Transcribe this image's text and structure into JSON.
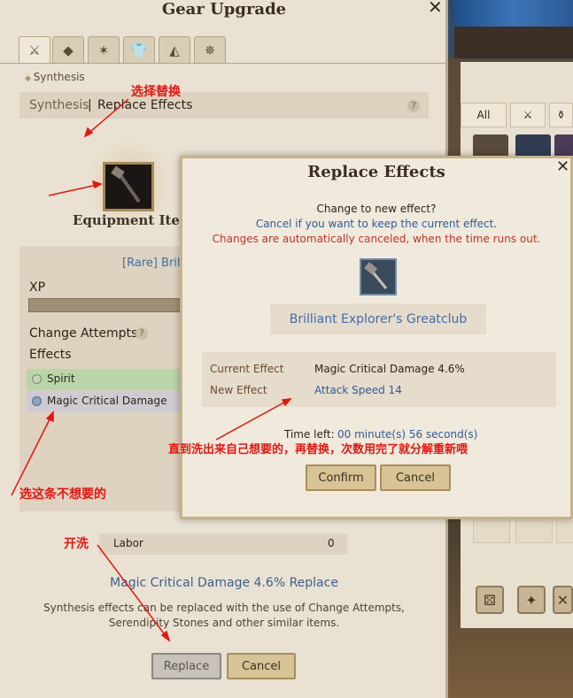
{
  "main": {
    "title": "Gear Upgrade",
    "close_glyph": "✕",
    "tabs": [
      "⚔",
      "◆",
      "✶",
      "👕",
      "◭",
      "✵"
    ],
    "breadcrumb": "Synthesis",
    "selection": {
      "synthesis": "Synthesis",
      "separator": "|",
      "replace": "Replace Effects",
      "help": "?"
    },
    "equipment_label": "Equipment Item",
    "item_name": "[Rare] Brilliant Explorer's Greatclub",
    "xp_label": "XP",
    "change_attempts_label": "Change Attempts",
    "effects_label": "Effects",
    "effects": [
      "Spirit",
      "Magic Critical Damage"
    ],
    "labor_label": "Labor",
    "labor_value": "0",
    "summary": "Magic Critical Damage 4.6% Replace",
    "desc_line1": "Synthesis effects can be replaced with the use of Change Attempts,",
    "desc_line2": "Serendipity Stones and other similar items.",
    "replace_button": "Replace",
    "cancel_button": "Cancel"
  },
  "dialog": {
    "title": "Replace Effects",
    "close_glyph": "✕",
    "line1": "Change to new effect?",
    "line2": "Cancel if you want to keep the current effect.",
    "line3": "Changes are automatically canceled, when the time runs out.",
    "item_name": "Brilliant Explorer's Greatclub",
    "current_effect_label": "Current Effect",
    "current_effect_value": "Magic Critical Damage 4.6%",
    "new_effect_label": "New Effect",
    "new_effect_value": "Attack Speed 14",
    "time_left_label": "Time left:",
    "time_left_value": "00 minute(s) 56 second(s)",
    "confirm_button": "Confirm",
    "cancel_button": "Cancel"
  },
  "inventory": {
    "all_tab": "All"
  },
  "annotations": {
    "select_replace": "选择替换",
    "select_unwanted": "选这条不想要的",
    "start_wash": "开洗",
    "until_wanted": "直到洗出来自己想要的，再替换，次数用完了就分解重新喂"
  },
  "colors": {
    "annotation_red": "#e8140f",
    "link_blue": "#3e6fa8",
    "warning_red": "#c03028"
  }
}
